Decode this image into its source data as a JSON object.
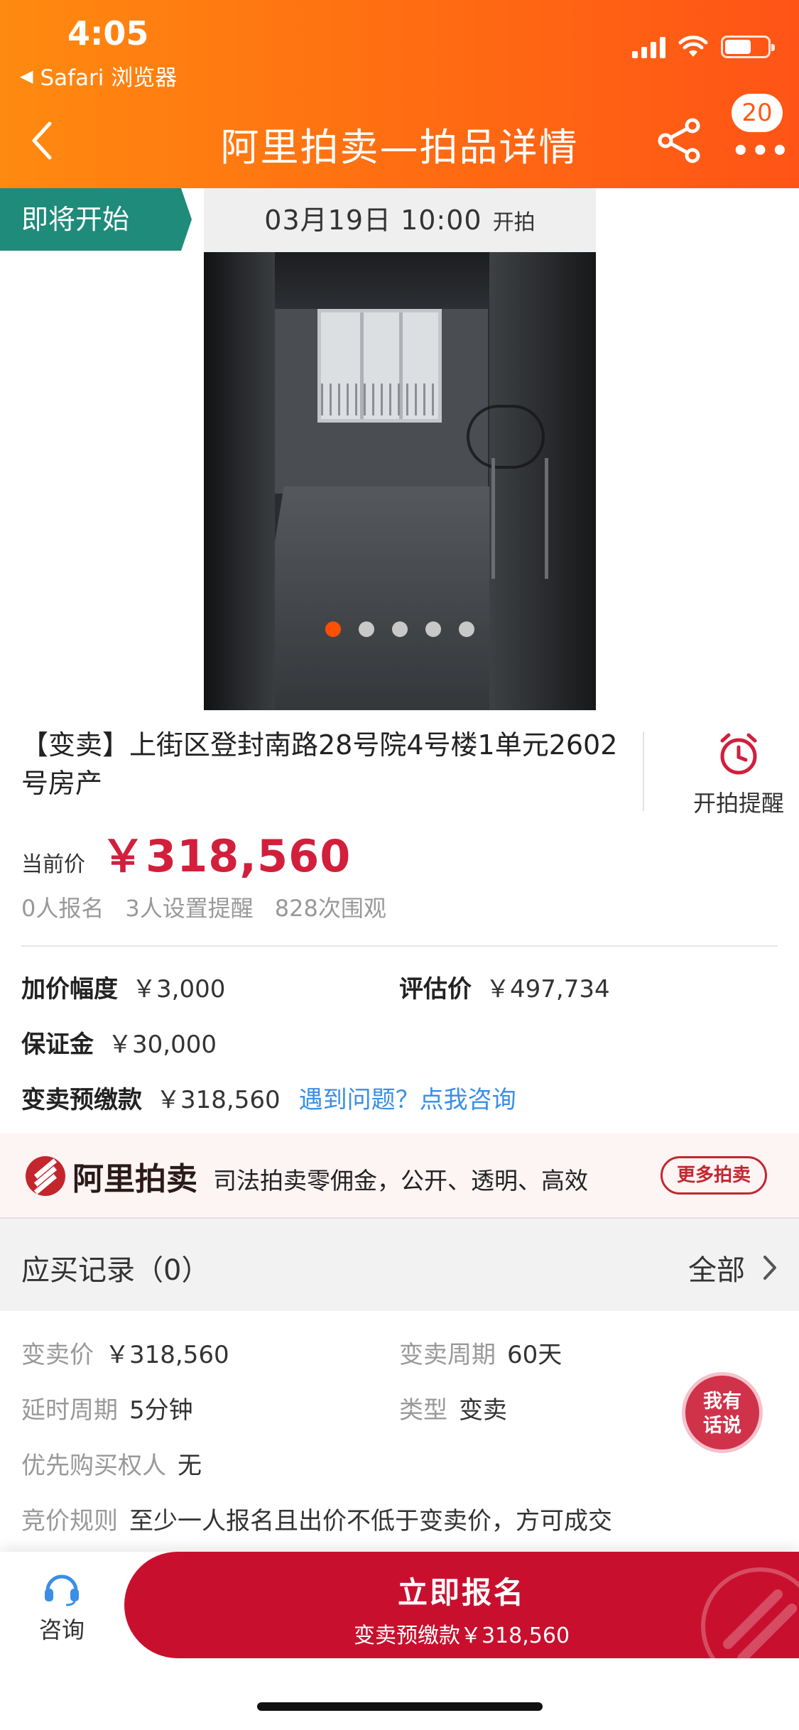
{
  "status_bar": {
    "time": "4:05",
    "back_app": "Safari 浏览器"
  },
  "nav": {
    "title": "阿里拍卖—拍品详情",
    "badge_count": "20",
    "more_label": "•••"
  },
  "auction_start": {
    "status_tag": "即将开始",
    "datetime": "03月19日  10:00",
    "suffix": "开拍"
  },
  "gallery": {
    "total_images": 5,
    "active_index": 0
  },
  "item": {
    "title": "【变卖】上街区登封南路28号院4号楼1单元2602号房产",
    "remind_label": "开拍提醒",
    "current_price_label": "当前价",
    "current_price": "￥318,560",
    "stats": [
      "0人报名",
      "3人设置提醒",
      "828次围观"
    ]
  },
  "terms": {
    "increment_label": "加价幅度",
    "increment_value": "￥3,000",
    "appraisal_label": "评估价",
    "appraisal_value": "￥497,734",
    "deposit_label": "保证金",
    "deposit_value": "￥30,000",
    "prepay_label": "变卖预缴款",
    "prepay_value": "￥318,560",
    "help_link": "遇到问题？点我咨询"
  },
  "ali_banner": {
    "brand": "阿里拍卖",
    "slogan": "司法拍卖零佣金，公开、透明、高效",
    "more_button": "更多拍卖"
  },
  "records": {
    "title": "应买记录（0）",
    "all_label": "全部"
  },
  "details": {
    "sell_price_label": "变卖价",
    "sell_price_value": "￥318,560",
    "sell_period_label": "变卖周期",
    "sell_period_value": "60天",
    "delay_label": "延时周期",
    "delay_value": "5分钟",
    "type_label": "类型",
    "type_value": "变卖",
    "priority_label": "优先购买权人",
    "priority_value": "无",
    "rule_label": "竞价规则",
    "rule_value": "至少一人报名且出价不低于变卖价，方可成交"
  },
  "float_chat": {
    "line1": "我有",
    "line2": "话说"
  },
  "bottom_bar": {
    "consult_label": "咨询",
    "signup_label": "立即报名",
    "signup_sub": "变卖预缴款￥318,560"
  },
  "colors": {
    "header_orange": "#ff6b12",
    "price_red": "#d21f3c",
    "tag_green": "#1f8b7a",
    "button_red": "#c8102e",
    "link_blue": "#3a8ee6"
  }
}
